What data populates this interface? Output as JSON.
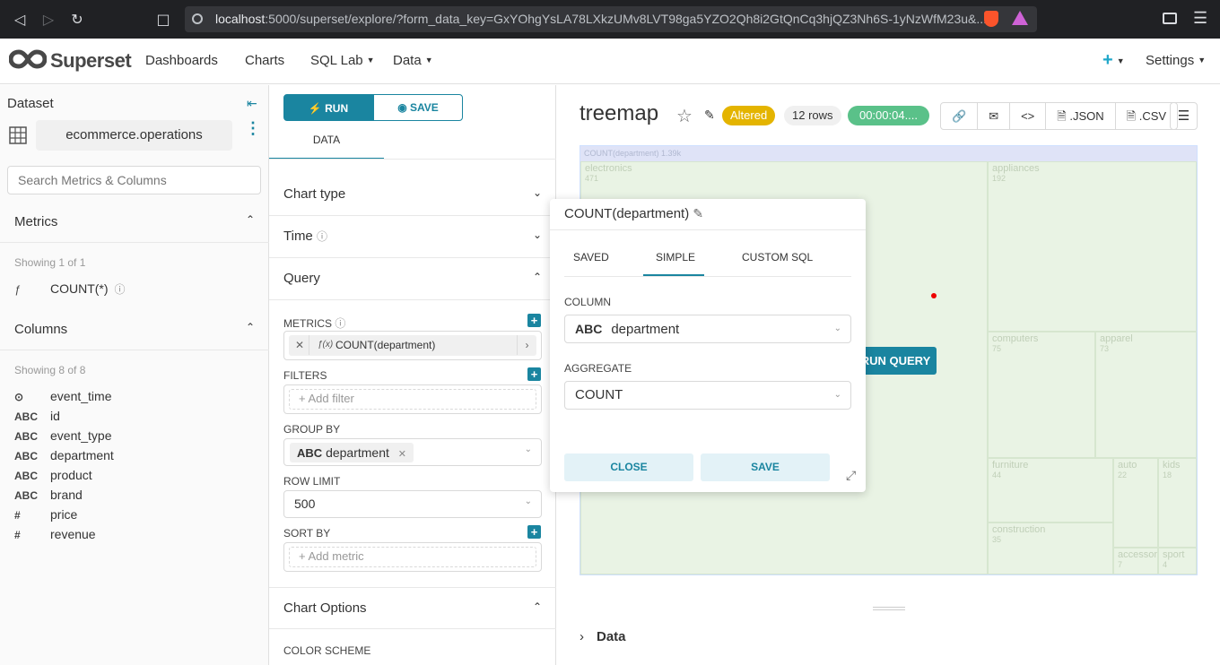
{
  "browser": {
    "url_host": "localhost",
    "url_rest": ":5000/superset/explore/?form_data_key=GxYOhgYsLA78LXkzUMv8LVT98ga5YZO2Qh8i2GtQnCq3hjQZ3Nh6S-1yNzWfM23u&..."
  },
  "header": {
    "brand": "Superset",
    "nav": [
      "Dashboards",
      "Charts",
      "SQL Lab",
      "Data"
    ],
    "settings": "Settings"
  },
  "dataset": {
    "title": "Dataset",
    "name": "ecommerce.operations",
    "search_placeholder": "Search Metrics & Columns",
    "metrics_title": "Metrics",
    "metrics_showing": "Showing 1 of 1",
    "metrics": [
      {
        "type": "ƒ",
        "name": "COUNT(*)"
      }
    ],
    "columns_title": "Columns",
    "columns_showing": "Showing 8 of 8",
    "columns": [
      {
        "type": "⊙",
        "name": "event_time"
      },
      {
        "type": "ABC",
        "name": "id"
      },
      {
        "type": "ABC",
        "name": "event_type"
      },
      {
        "type": "ABC",
        "name": "department"
      },
      {
        "type": "ABC",
        "name": "product"
      },
      {
        "type": "ABC",
        "name": "brand"
      },
      {
        "type": "#",
        "name": "price"
      },
      {
        "type": "#",
        "name": "revenue"
      }
    ]
  },
  "controls": {
    "run": "RUN",
    "save": "SAVE",
    "tab": "DATA",
    "sections": [
      "Chart type",
      "Time",
      "Query",
      "Chart Options"
    ],
    "metrics_label": "METRICS",
    "metric_value": "COUNT(department)",
    "filters_label": "FILTERS",
    "add_filter": "Add filter",
    "groupby_label": "GROUP BY",
    "groupby_type": "ABC",
    "groupby_value": "department",
    "rowlimit_label": "ROW LIMIT",
    "rowlimit_value": "500",
    "sortby_label": "SORT BY",
    "add_metric": "Add metric",
    "color_scheme_label": "COLOR SCHEME"
  },
  "chart": {
    "title": "treemap",
    "badge_altered": "Altered",
    "badge_rows": "12 rows",
    "badge_time": "00:00:04....",
    "toolbar": [
      ".JSON",
      ".CSV"
    ],
    "run_query": "RUN QUERY",
    "data_section": "Data"
  },
  "chart_data": {
    "type": "treemap",
    "root": {
      "label": "COUNT(department)",
      "value": "1.39k"
    },
    "cells": [
      {
        "label": "electronics",
        "value": "471"
      },
      {
        "label": "appliances",
        "value": "192"
      },
      {
        "label": "computers",
        "value": "75"
      },
      {
        "label": "apparel",
        "value": "73"
      },
      {
        "label": "furniture",
        "value": "44"
      },
      {
        "label": "construction",
        "value": "35"
      },
      {
        "label": "auto",
        "value": "22"
      },
      {
        "label": "kids",
        "value": "18"
      },
      {
        "label": "accessor",
        "value": "7"
      },
      {
        "label": "sport",
        "value": "4"
      }
    ]
  },
  "popover": {
    "title": "COUNT(department)",
    "tabs": [
      "SAVED",
      "SIMPLE",
      "CUSTOM SQL"
    ],
    "column_label": "COLUMN",
    "column_type": "ABC",
    "column_value": "department",
    "aggregate_label": "AGGREGATE",
    "aggregate_value": "COUNT",
    "close": "CLOSE",
    "save": "SAVE"
  }
}
